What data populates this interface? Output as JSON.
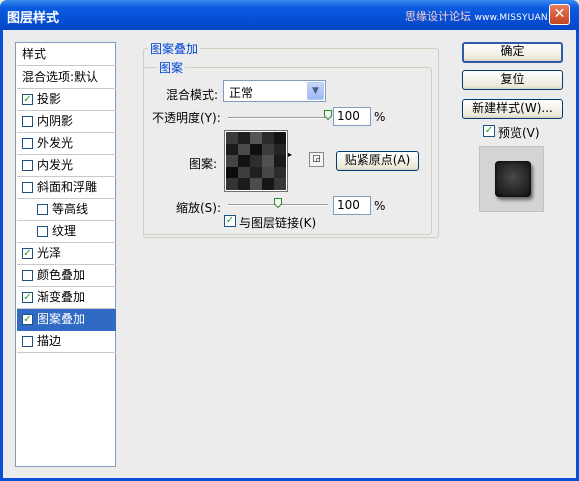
{
  "window": {
    "title": "图层样式",
    "watermark_cn": "思缘设计论坛",
    "watermark_url": "www.MISSYUAN.com",
    "close_glyph": "✕"
  },
  "style_list": {
    "header": "样式",
    "blend_options": "混合选项:默认",
    "items": [
      {
        "label": "投影",
        "checked": "✓"
      },
      {
        "label": "内阴影",
        "checked": ""
      },
      {
        "label": "外发光",
        "checked": ""
      },
      {
        "label": "内发光",
        "checked": ""
      },
      {
        "label": "斜面和浮雕",
        "checked": ""
      },
      {
        "label": "等高线",
        "checked": ""
      },
      {
        "label": "纹理",
        "checked": ""
      },
      {
        "label": "光泽",
        "checked": "✓"
      },
      {
        "label": "颜色叠加",
        "checked": ""
      },
      {
        "label": "渐变叠加",
        "checked": "✓"
      },
      {
        "label": "图案叠加",
        "checked": "✓"
      },
      {
        "label": "描边",
        "checked": ""
      }
    ]
  },
  "panel": {
    "group_title": "图案叠加",
    "subgroup_title": "图案",
    "blend_mode_label": "混合模式:",
    "blend_mode_value": "正常",
    "opacity_label": "不透明度(Y):",
    "opacity_value": "100",
    "opacity_percent": 1.0,
    "pattern_label": "图案:",
    "snap_origin_button": "贴紧原点(A)",
    "scale_label": "缩放(S):",
    "scale_value": "100",
    "scale_position": 0.5,
    "percent_sign": "%",
    "link_layer_label": "与图层链接(K)",
    "link_layer_checked": "✓"
  },
  "buttons": {
    "ok": "确定",
    "reset": "复位",
    "new_style": "新建样式(W)...",
    "preview_label": "预览(V)",
    "preview_checked": "✓"
  },
  "icons": {
    "dropdown": "▼",
    "pattern_menu": "▸",
    "snap_icon": "◲"
  },
  "colors": {
    "titlebar": "#0650d6",
    "selection": "#316ac5",
    "legend_text": "#0046d5",
    "check": "#21a121"
  }
}
